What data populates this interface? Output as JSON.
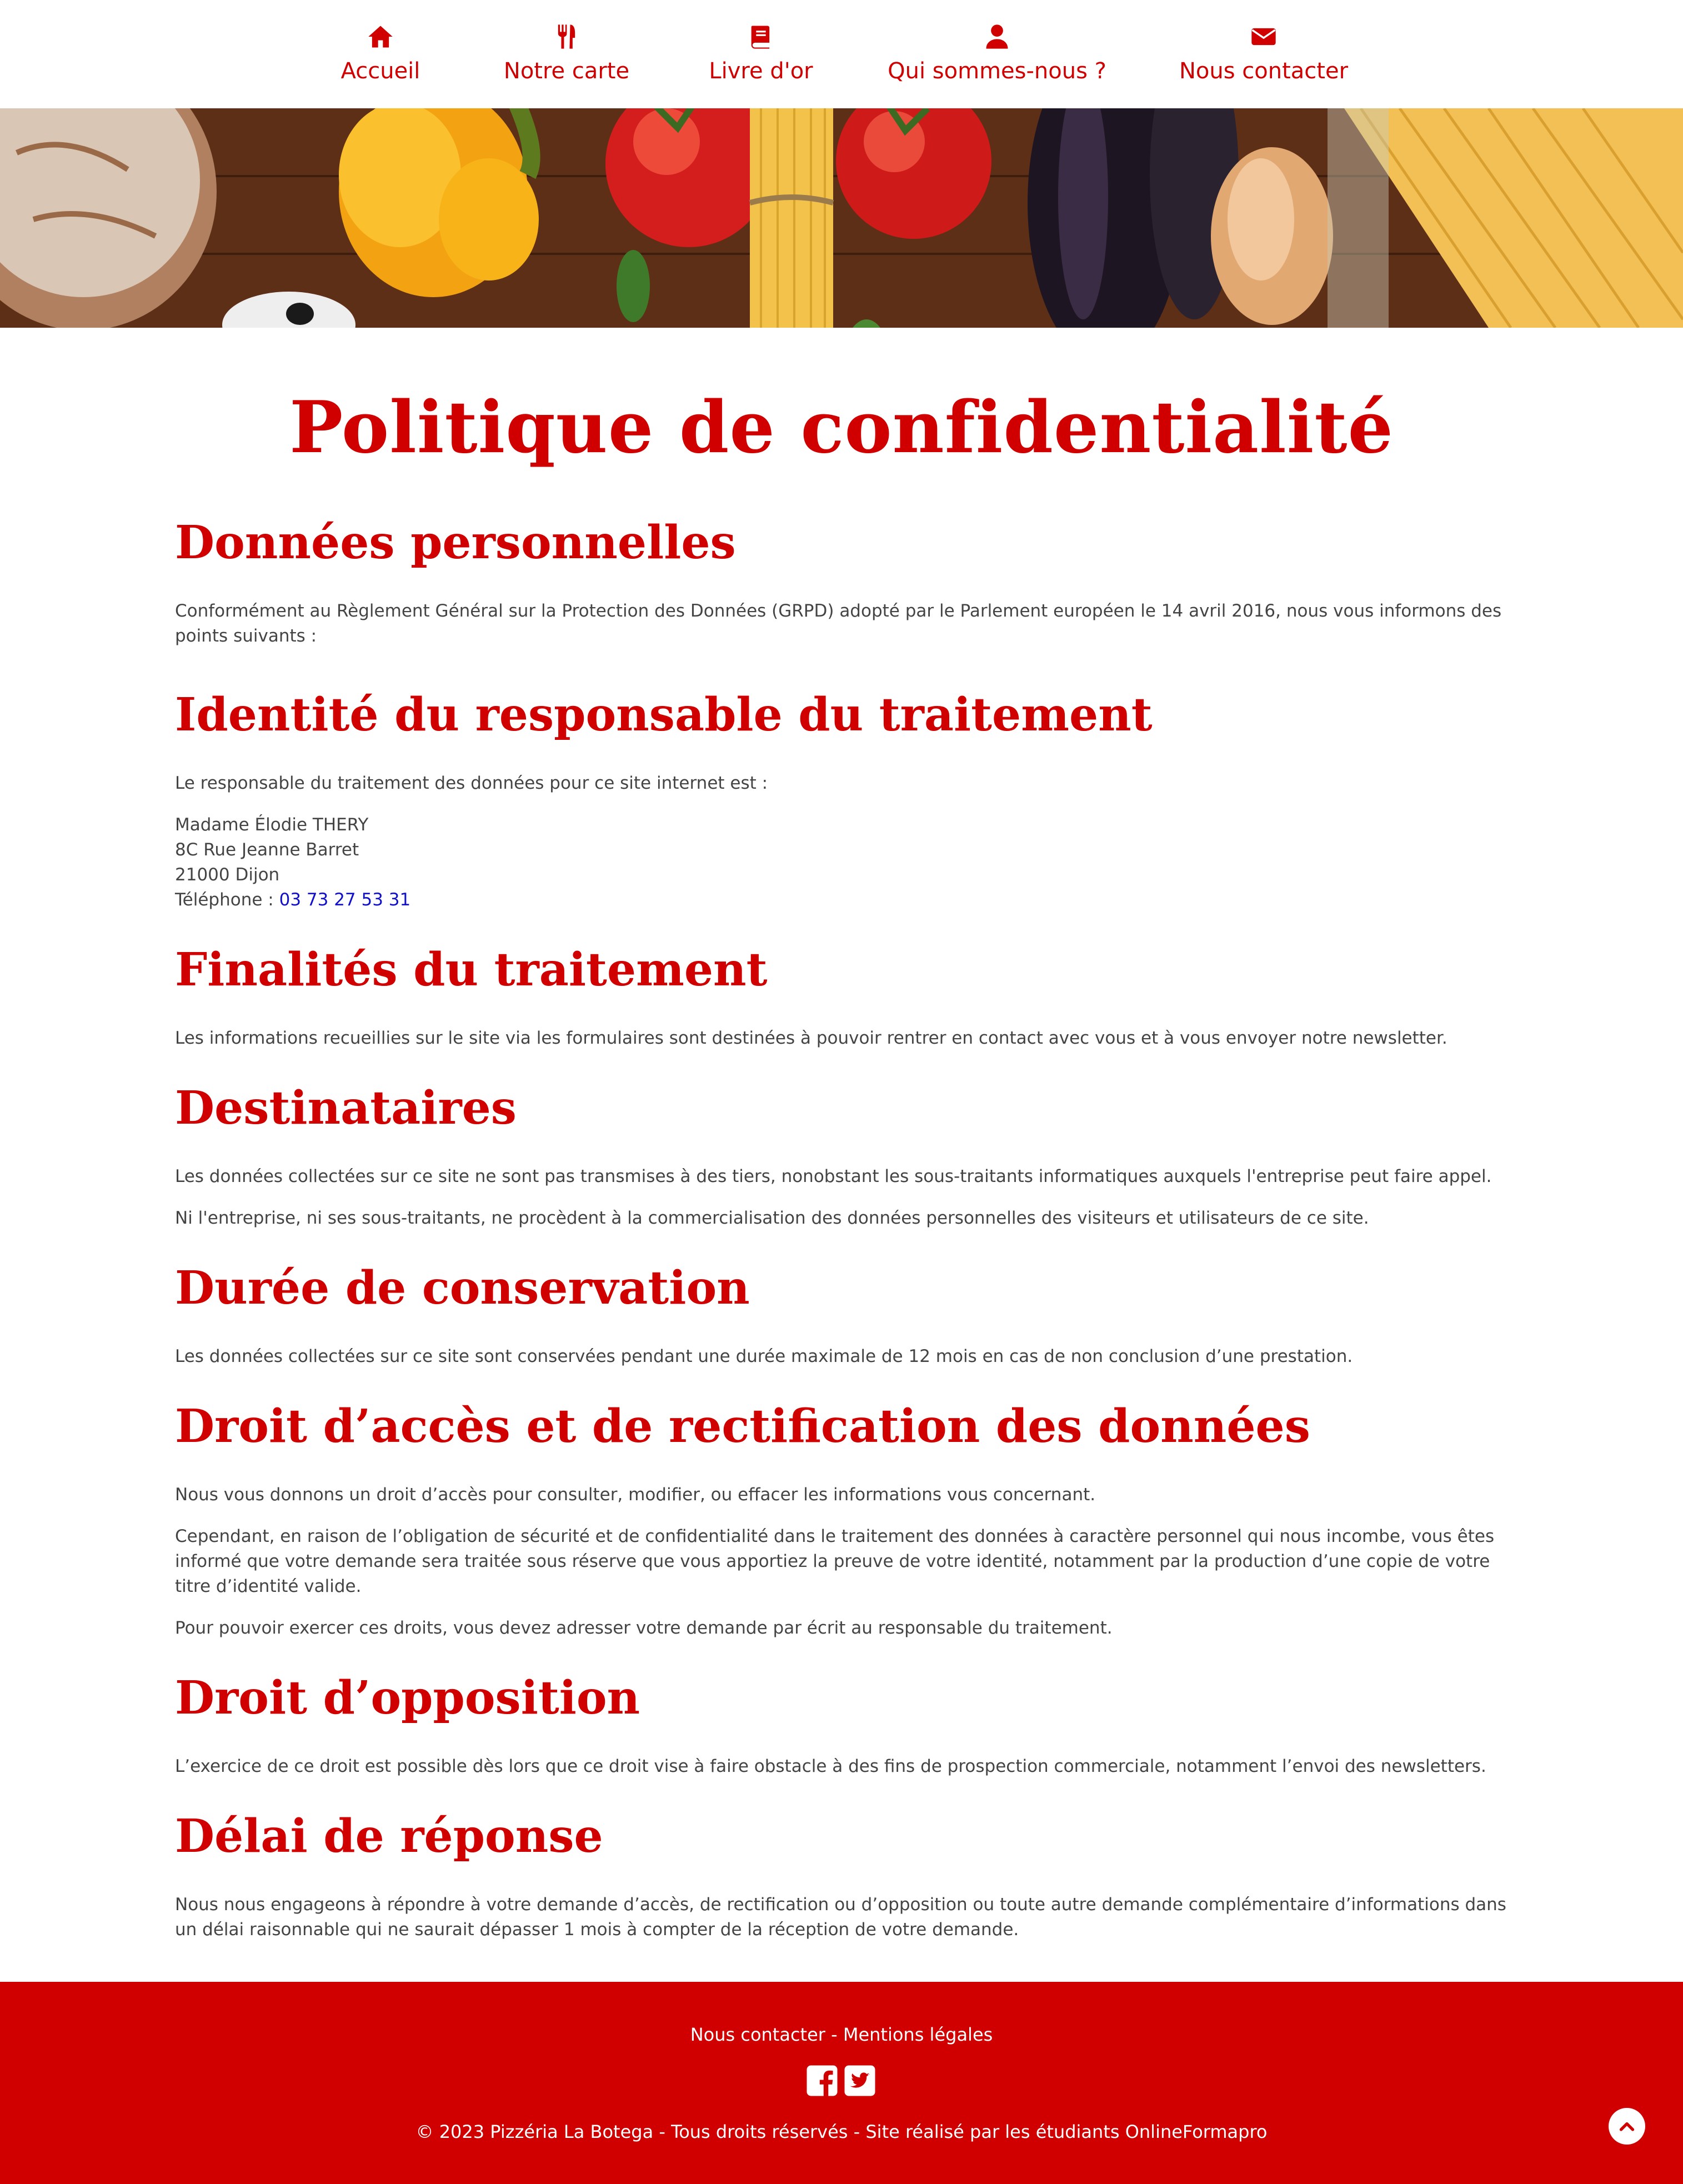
{
  "nav": {
    "items": [
      {
        "label": "Accueil",
        "icon": "home-icon"
      },
      {
        "label": "Notre carte",
        "icon": "utensils-icon"
      },
      {
        "label": "Livre d'or",
        "icon": "book-icon"
      },
      {
        "label": "Qui sommes-nous ?",
        "icon": "user-icon"
      },
      {
        "label": "Nous contacter",
        "icon": "envelope-icon"
      }
    ]
  },
  "colors": {
    "brand_red": "#d00000",
    "text": "#444444",
    "link_blue": "#1010c8"
  },
  "page": {
    "title": "Politique de confidentialité"
  },
  "sections": {
    "personal_data": {
      "title": "Données personnelles",
      "p1": "Conformément au Règlement Général sur la Protection des Données (GRPD) adopté par le Parlement européen le 14 avril 2016, nous vous informons des points suivants :"
    },
    "controller": {
      "title": "Identité du responsable du traitement",
      "p1": "Le responsable du traitement des données pour ce site internet est :",
      "name": "Madame Élodie THERY",
      "street": "8C Rue Jeanne Barret",
      "city": "21000 Dijon",
      "phone_label": "Téléphone : ",
      "phone": "03 73 27 53 31"
    },
    "purposes": {
      "title": "Finalités du traitement",
      "p1": "Les informations recueillies sur le site via les formulaires sont destinées à pouvoir rentrer en contact avec vous et à vous envoyer notre newsletter."
    },
    "recipients": {
      "title": "Destinataires",
      "p1": "Les données collectées sur ce site ne sont pas transmises à des tiers, nonobstant les sous-traitants informatiques auxquels l'entreprise peut faire appel.",
      "p2": "Ni l'entreprise, ni ses sous-traitants, ne procèdent à la commercialisation des données personnelles des visiteurs et utilisateurs de ce site."
    },
    "retention": {
      "title": "Durée de conservation",
      "p1": "Les données collectées sur ce site sont conservées pendant une durée maximale de 12 mois en cas de non conclusion d’une prestation."
    },
    "access": {
      "title": "Droit d’accès et de rectification des données",
      "p1": "Nous vous donnons un droit d’accès pour consulter, modifier, ou effacer les informations vous concernant.",
      "p2": "Cependant, en raison de l’obligation de sécurité et de confidentialité dans le traitement des données à caractère personnel qui nous incombe, vous êtes informé que votre demande sera traitée sous réserve que vous apportiez la preuve de votre identité, notamment par la production d’une copie de votre titre d’identité valide.",
      "p3": "Pour pouvoir exercer ces droits, vous devez adresser votre demande par écrit au responsable du traitement."
    },
    "opposition": {
      "title": "Droit d’opposition",
      "p1": "L’exercice de ce droit est possible dès lors que ce droit vise à faire obstacle à des fins de prospection commerciale, notamment l’envoi des newsletters."
    },
    "delay": {
      "title": "Délai de réponse",
      "p1": "Nous nous engageons à répondre à votre demande d’accès, de rectification ou d’opposition ou toute autre demande complémentaire d’informations dans un délai raisonnable qui ne saurait dépasser 1 mois à compter de la réception de votre demande."
    }
  },
  "footer": {
    "contact_link": "Nous contacter",
    "separator": " - ",
    "legal_link": "Mentions légales",
    "social": [
      "facebook-icon",
      "twitter-icon"
    ],
    "copyright": "© 2023 Pizzéria La Botega - Tous droits réservés - Site réalisé par les étudiants OnlineFormapro"
  }
}
